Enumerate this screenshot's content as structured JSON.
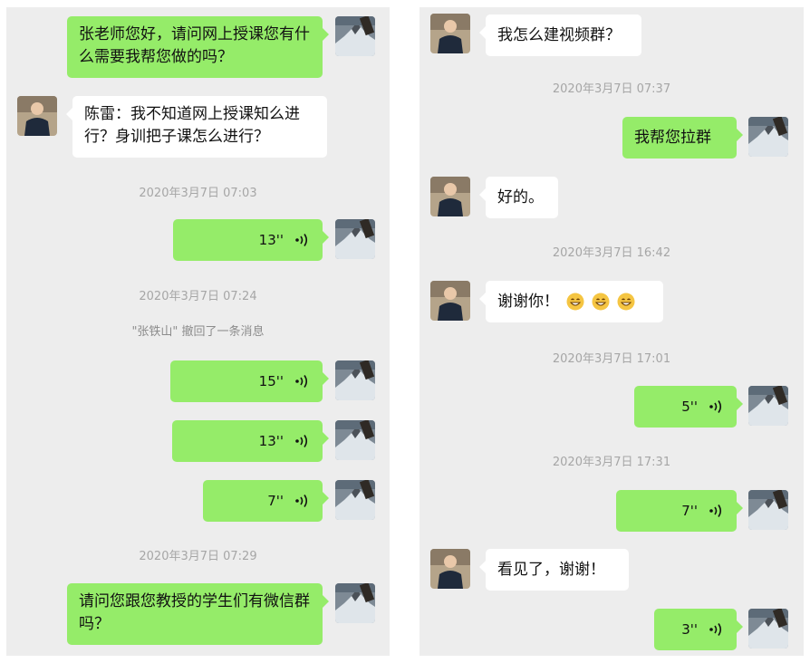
{
  "left": {
    "msg1": "张老师您好，请问网上授课您有什么需要我帮您做的吗？",
    "msg2": "陈雷：我不知道网上授课知么进行？身训把子课怎么进行？",
    "ts1": "2020年3月7日 07:03",
    "voice1": "13''",
    "ts2": "2020年3月7日 07:24",
    "recall_notice": "\"张铁山\" 撤回了一条消息",
    "voice2": "15''",
    "voice3": "13''",
    "voice4": "7''",
    "ts3": "2020年3月7日 07:29",
    "msg3": "请问您跟您教授的学生们有微信群吗？"
  },
  "right": {
    "msg1": "我怎么建视频群？",
    "ts1": "2020年3月7日 07:37",
    "msg2": "我帮您拉群",
    "msg3": "好的。",
    "ts2": "2020年3月7日 16:42",
    "msg4": "谢谢你！",
    "msg4_emoji": [
      "grin-emoji",
      "grin-emoji",
      "grin-emoji"
    ],
    "ts3": "2020年3月7日 17:01",
    "voice1": "5''",
    "ts4": "2020年3月7日 17:31",
    "voice2": "7''",
    "msg5": "看见了，谢谢！",
    "voice3": "3''"
  },
  "colors": {
    "background": "#ededed",
    "my_bubble": "#95ec69",
    "other_bubble": "#ffffff",
    "timestamp_text": "#a6a6a6"
  }
}
